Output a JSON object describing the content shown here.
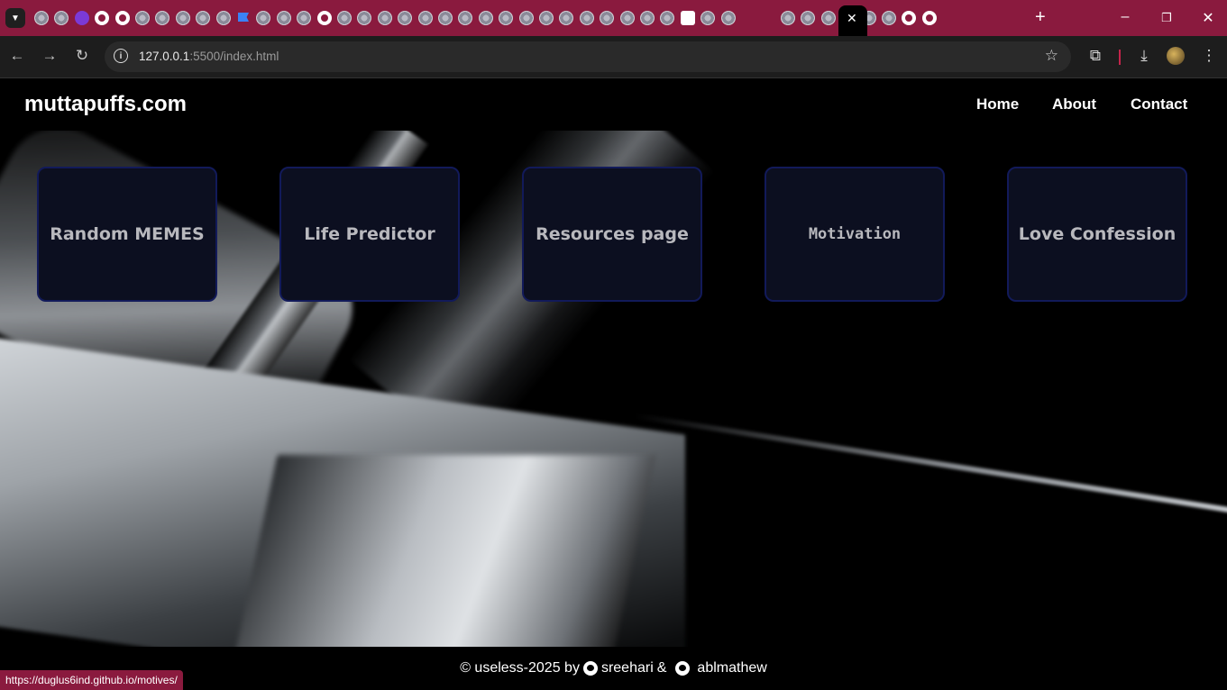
{
  "browser": {
    "url_host": "127.0.0.1",
    "url_rest": ":5500/index.html",
    "accent_color": "#8a1a3e",
    "tab_favicons": [
      "globe",
      "globe",
      "u",
      "github",
      "github",
      "globe",
      "globe",
      "globe",
      "globe",
      "globe",
      "flag",
      "globe",
      "globe",
      "globe",
      "github",
      "globe",
      "globe",
      "globe",
      "globe",
      "globe",
      "globe",
      "globe",
      "globe",
      "globe",
      "globe",
      "globe",
      "globe",
      "globe",
      "globe",
      "globe",
      "globe",
      "globe",
      "p",
      "globe",
      "globe",
      "active",
      "globe",
      "globe",
      "globe",
      "pinterest",
      "globe",
      "globe",
      "github",
      "github"
    ],
    "status_url": "https://duglus6ind.github.io/motives/"
  },
  "site": {
    "logo": "muttapuffs.com",
    "nav": {
      "home": "Home",
      "about": "About",
      "contact": "Contact"
    },
    "cards": [
      {
        "label": "Random MEMES",
        "font": "sans"
      },
      {
        "label": "Life Predictor",
        "font": "sans"
      },
      {
        "label": "Resources page",
        "font": "sans"
      },
      {
        "label": "Motivation",
        "font": "mono"
      },
      {
        "label": "Love Confession",
        "font": "sans"
      }
    ],
    "footer": {
      "prefix": "© useless-2025 by",
      "author1": "sreehari",
      "amp": "&",
      "author2": "ablmathew"
    }
  }
}
